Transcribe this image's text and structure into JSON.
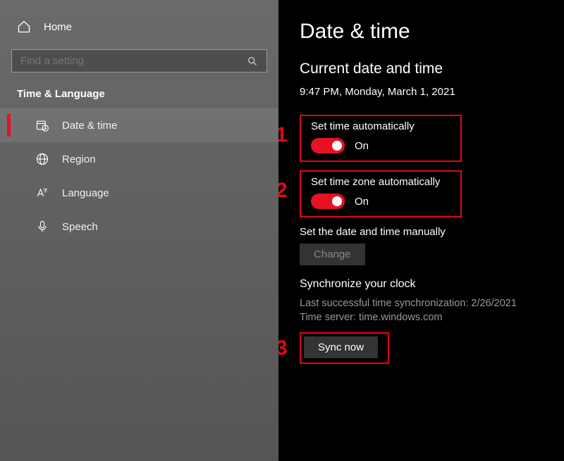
{
  "sidebar": {
    "home": "Home",
    "search_placeholder": "Find a setting",
    "section": "Time & Language",
    "items": [
      {
        "label": "Date & time"
      },
      {
        "label": "Region"
      },
      {
        "label": "Language"
      },
      {
        "label": "Speech"
      }
    ]
  },
  "main": {
    "title": "Date & time",
    "current_heading": "Current date and time",
    "current_value": "9:47 PM, Monday, March 1, 2021",
    "set_time_auto": {
      "label": "Set time automatically",
      "state": "On"
    },
    "set_tz_auto": {
      "label": "Set time zone automatically",
      "state": "On"
    },
    "manual": {
      "label": "Set the date and time manually",
      "button": "Change"
    },
    "sync": {
      "heading": "Synchronize your clock",
      "last": "Last successful time synchronization: 2/26/2021",
      "server": "Time server: time.windows.com",
      "button": "Sync now"
    }
  },
  "annotations": {
    "one": "1",
    "two": "2",
    "three": "3"
  }
}
